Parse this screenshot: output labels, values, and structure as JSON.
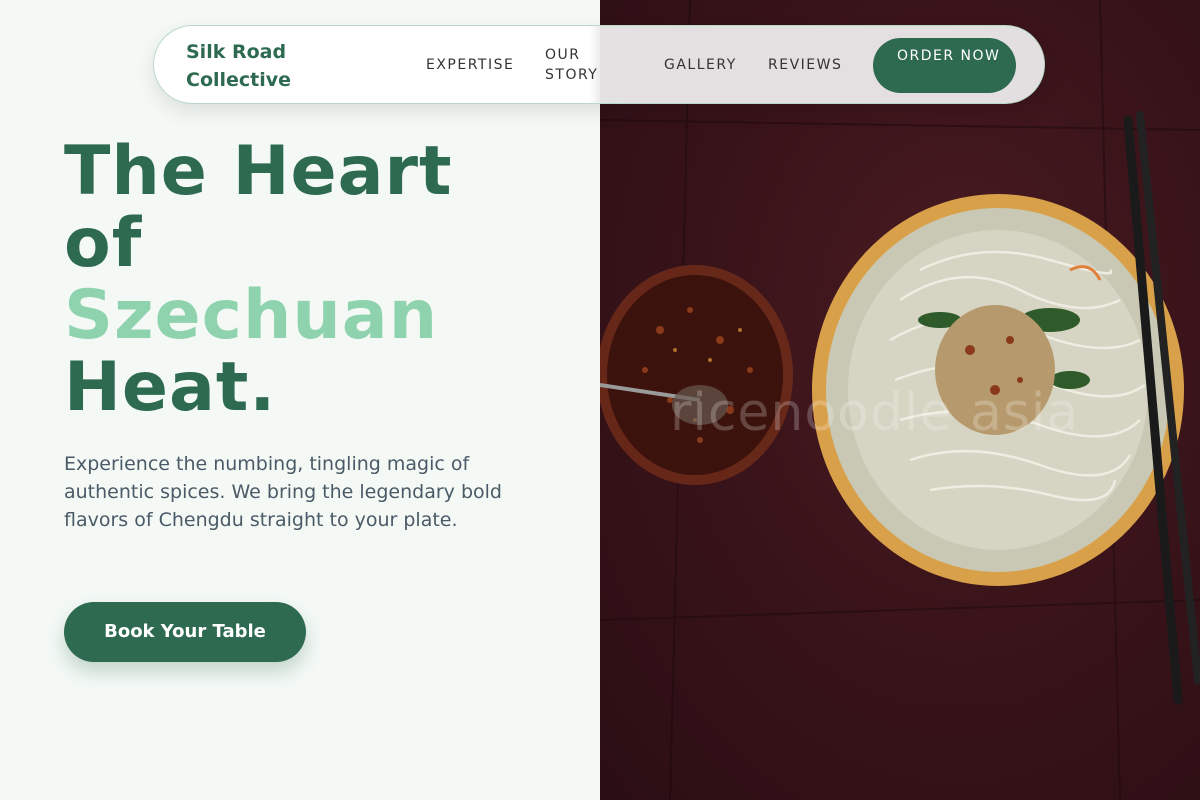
{
  "brand": {
    "name": "Silk Road Collective"
  },
  "nav": {
    "links": [
      "EXPERTISE",
      "OUR STORY",
      "GALLERY",
      "REVIEWS"
    ],
    "cta": "ORDER NOW"
  },
  "hero": {
    "headline_line1": "The Heart",
    "headline_line2": "of",
    "headline_accent": "Szechuan",
    "headline_line4": "Heat.",
    "description": "Experience the numbing, tingling magic of authentic spices. We bring the legendary bold flavors of Chengdu straight to your plate.",
    "cta": "Book Your Table"
  },
  "photo": {
    "watermark": "ricenoodle asia",
    "icons": [
      "noodle-plate-icon",
      "chili-oil-bowl-icon",
      "chopsticks-icon"
    ]
  },
  "colors": {
    "primary": "#2e6a50",
    "accent": "#8fd3ae",
    "background": "#f4f9f6",
    "photo_bg": "#3a141a"
  }
}
